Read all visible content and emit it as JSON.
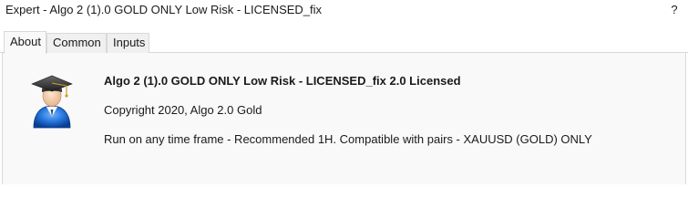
{
  "window": {
    "title": "Expert - Algo 2 (1).0 GOLD ONLY Low Risk - LICENSED_fix",
    "help_label": "?"
  },
  "tabs": [
    {
      "label": "About",
      "active": true
    },
    {
      "label": "Common",
      "active": false
    },
    {
      "label": "Inputs",
      "active": false
    }
  ],
  "about": {
    "icon": "graduate-user-icon",
    "title": "Algo 2 (1).0 GOLD ONLY Low Risk - LICENSED_fix 2.0 Licensed",
    "copyright": "Copyright 2020, Algo 2.0 Gold",
    "description": "Run on any time frame - Recommended 1H. Compatible with pairs - XAUUSD (GOLD) ONLY"
  }
}
